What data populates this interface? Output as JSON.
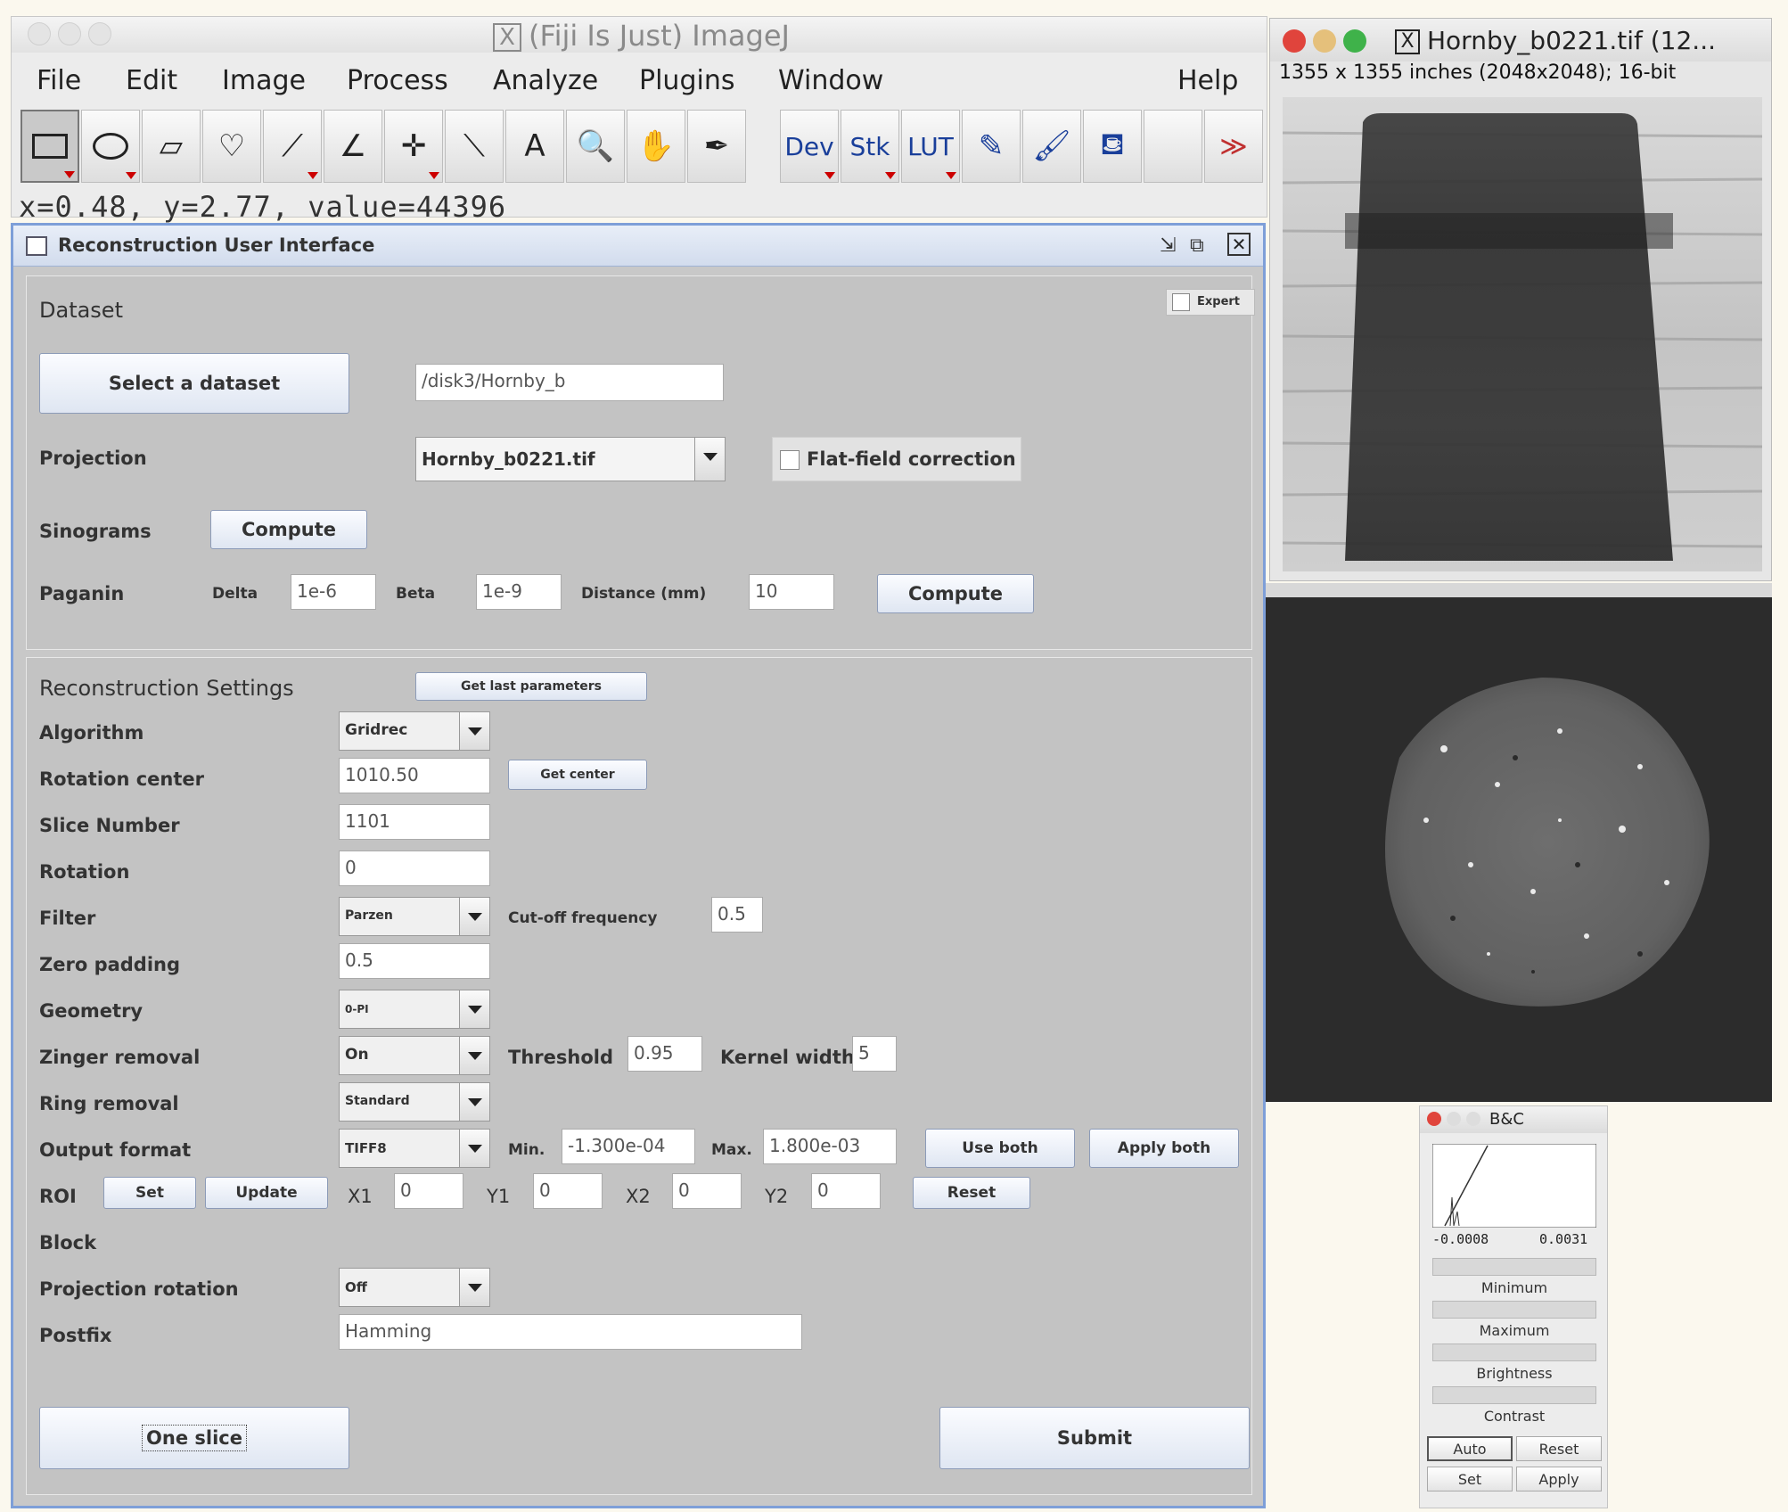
{
  "imagej": {
    "title": "(Fiji Is Just) ImageJ",
    "menus": [
      "File",
      "Edit",
      "Image",
      "Process",
      "Analyze",
      "Plugins",
      "Window",
      "Help"
    ],
    "toolbar": {
      "dev": "Dev",
      "stk": "Stk",
      "lut": "LUT"
    },
    "status": "x=0.48, y=2.77, value=44396"
  },
  "recon": {
    "title": "Reconstruction User Interface",
    "expert": "Expert",
    "dataset": {
      "heading": "Dataset",
      "select_button": "Select a dataset",
      "path": "/disk3/Hornby_b",
      "projection_label": "Projection",
      "projection_value": "Hornby_b0221.tif",
      "flatfield_label": "Flat-field correction",
      "sinograms_label": "Sinograms",
      "sinograms_button": "Compute",
      "paganin_label": "Paganin",
      "delta_label": "Delta",
      "delta_value": "1e-6",
      "beta_label": "Beta",
      "beta_value": "1e-9",
      "distance_label": "Distance (mm)",
      "distance_value": "10",
      "paganin_button": "Compute"
    },
    "settings": {
      "heading": "Reconstruction Settings",
      "get_last": "Get last parameters",
      "algorithm_label": "Algorithm",
      "algorithm_value": "Gridrec",
      "rotation_center_label": "Rotation center",
      "rotation_center_value": "1010.50",
      "get_center": "Get center",
      "slice_label": "Slice Number",
      "slice_value": "1101",
      "rotation_label": "Rotation",
      "rotation_value": "0",
      "filter_label": "Filter",
      "filter_value": "Parzen",
      "cutoff_label": "Cut-off frequency",
      "cutoff_value": "0.5",
      "zero_padding_label": "Zero padding",
      "zero_padding_value": "0.5",
      "geometry_label": "Geometry",
      "geometry_value": "0-PI",
      "zinger_label": "Zinger removal",
      "zinger_value": "On",
      "threshold_label": "Threshold",
      "threshold_value": "0.95",
      "kernel_label": "Kernel width",
      "kernel_value": "5",
      "ring_label": "Ring removal",
      "ring_value": "Standard",
      "output_label": "Output format",
      "output_value": "TIFF8",
      "min_label": "Min.",
      "min_value": "-1.300e-04",
      "max_label": "Max.",
      "max_value": "1.800e-03",
      "use_both": "Use both",
      "apply_both": "Apply both",
      "roi_label": "ROI",
      "roi_set": "Set",
      "roi_update": "Update",
      "x1_label": "X1",
      "x1_value": "0",
      "y1_label": "Y1",
      "y1_value": "0",
      "x2_label": "X2",
      "x2_value": "0",
      "y2_label": "Y2",
      "y2_value": "0",
      "reset": "Reset",
      "block_label": "Block",
      "proj_rot_label": "Projection rotation",
      "proj_rot_value": "Off",
      "postfix_label": "Postfix",
      "postfix_value": "Hamming",
      "one_slice": "One slice",
      "submit": "Submit"
    }
  },
  "image_window": {
    "title": "Hornby_b0221.tif (12...",
    "subtitle": "1355 x 1355 inches (2048x2048); 16-bit"
  },
  "bc": {
    "title": "B&C",
    "min_readout": "-0.0008",
    "max_readout": "0.0031",
    "minimum": "Minimum",
    "maximum": "Maximum",
    "brightness": "Brightness",
    "contrast": "Contrast",
    "auto": "Auto",
    "reset": "Reset",
    "set": "Set",
    "apply": "Apply"
  },
  "colors": {
    "title_blue": "#7e9fd8",
    "close_red": "#e0443c",
    "min_yellow": "#e5b73b",
    "max_green": "#3fb24a"
  }
}
